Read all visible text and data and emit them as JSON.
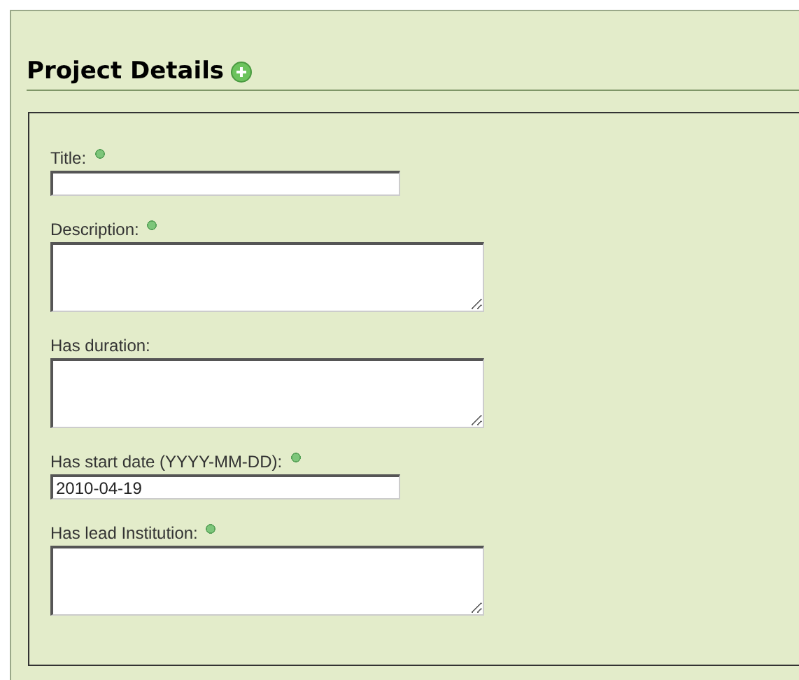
{
  "section": {
    "title": "Project Details"
  },
  "fields": [
    {
      "label": "Title:",
      "kind": "input",
      "required": true
    },
    {
      "label": "Description:",
      "kind": "textarea",
      "required": true
    },
    {
      "label": "Has duration:",
      "kind": "textarea",
      "required": false
    },
    {
      "label": "Has start date (YYYY-MM-DD):",
      "kind": "input",
      "required": true,
      "value": "2010-04-19"
    },
    {
      "label": "Has lead Institution:",
      "kind": "textarea",
      "required": true
    }
  ]
}
